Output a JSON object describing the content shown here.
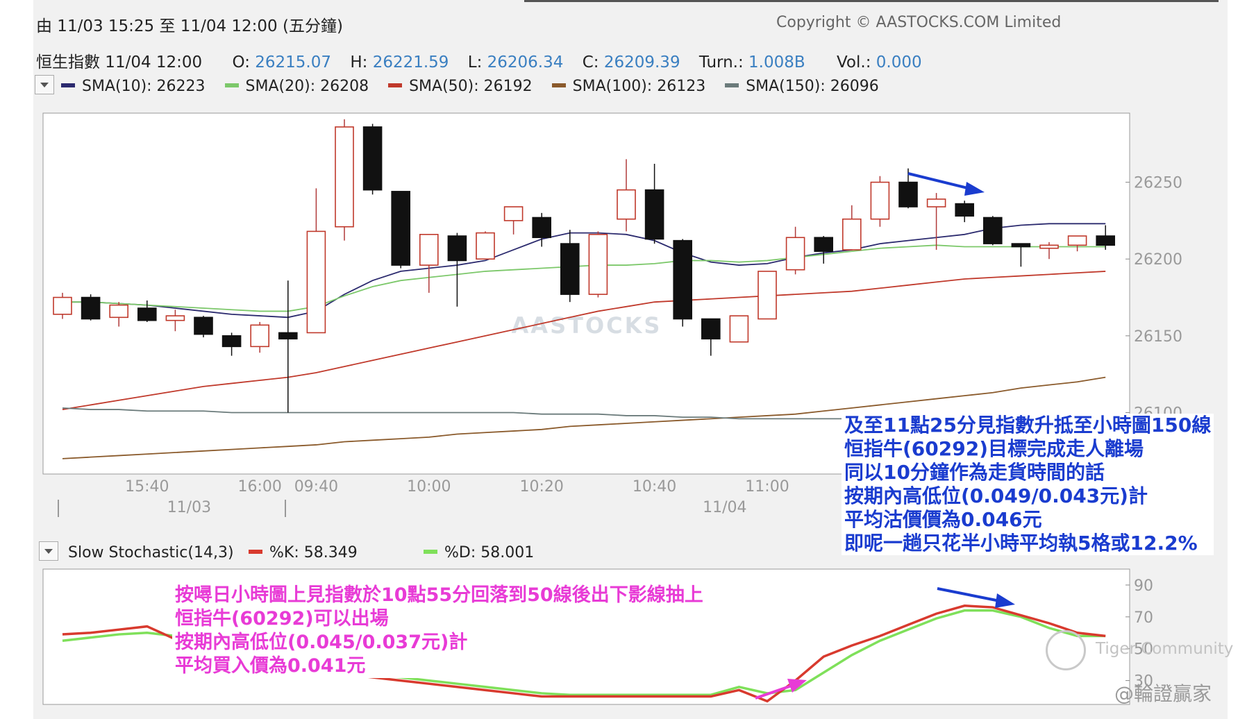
{
  "header": {
    "range": "由 11/03 15:25 至 11/04 12:00 (五分鐘)",
    "copyright": "Copyright © AASTOCKS.COM Limited"
  },
  "quote": {
    "name_time": "恒生指數 11/04 12:00",
    "o_label": "O:",
    "o_value": "26215.07",
    "h_label": "H:",
    "h_value": "26221.59",
    "l_label": "L:",
    "l_value": "26206.34",
    "c_label": "C:",
    "c_value": "26209.39",
    "turn_label": "Turn.:",
    "turn_value": "1.008B",
    "vol_label": "Vol.:",
    "vol_value": "0.000"
  },
  "sma_legend": [
    {
      "label": "SMA(10): 26223",
      "color": "#2b2a6e"
    },
    {
      "label": "SMA(20): 26208",
      "color": "#7cc86a"
    },
    {
      "label": "SMA(50): 26192",
      "color": "#c0392b"
    },
    {
      "label": "SMA(100): 26123",
      "color": "#8a5a2b"
    },
    {
      "label": "SMA(150): 26096",
      "color": "#6b7b7b"
    }
  ],
  "stoch": {
    "title": "Slow Stochastic(14,3)",
    "k_label": "%K: 58.349",
    "k_color": "#d83a2e",
    "d_label": "%D: 58.001",
    "d_color": "#7fe05a"
  },
  "watermarks": {
    "main": "AASTOCKS",
    "community": "Tiger Community",
    "author": "@輪證贏家"
  },
  "annotations": {
    "blue": [
      "及至11點25分見指數升抵至小時圖150線",
      "恒指牛(60292)目標完成走人離場",
      "同以10分鐘作為走貨時間的話",
      "按期內高低位(0.049/0.043元)計",
      "平均沽價價為0.046元",
      "即呢一趟只花半小時平均執5格或12.2%"
    ],
    "pink": [
      "按噚日小時圖上見指數於10點55分回落到50線後出下影線抽上",
      "恒指牛(60292)可以出場",
      "按期內高低位(0.045/0.037元)計",
      "平均買入價為0.041元"
    ]
  },
  "chart_data": [
    {
      "type": "candlestick",
      "title": "恒生指數",
      "ylim": [
        26060,
        26295
      ],
      "y_ticks": [
        26100,
        26150,
        26200,
        26250
      ],
      "time_ticks": [
        {
          "index": 3,
          "label": "15:40"
        },
        {
          "index": 7,
          "label": "16:00"
        },
        {
          "index": 9,
          "label": "09:40"
        },
        {
          "index": 13,
          "label": "10:00"
        },
        {
          "index": 17,
          "label": "10:20"
        },
        {
          "index": 21,
          "label": "10:40"
        },
        {
          "index": 25,
          "label": "11:00"
        }
      ],
      "date_labels": [
        {
          "index": 4,
          "label": "11/03"
        },
        {
          "index": 23,
          "label": "11/04"
        }
      ],
      "candles": [
        {
          "o": 26164,
          "h": 26178,
          "l": 26161,
          "c": 26175
        },
        {
          "o": 26175,
          "h": 26177,
          "l": 26160,
          "c": 26161
        },
        {
          "o": 26162,
          "h": 26172,
          "l": 26156,
          "c": 26170
        },
        {
          "o": 26168,
          "h": 26173,
          "l": 26159,
          "c": 26160
        },
        {
          "o": 26160,
          "h": 26167,
          "l": 26153,
          "c": 26163
        },
        {
          "o": 26162,
          "h": 26163,
          "l": 26149,
          "c": 26151
        },
        {
          "o": 26150,
          "h": 26152,
          "l": 26137,
          "c": 26143
        },
        {
          "o": 26143,
          "h": 26159,
          "l": 26139,
          "c": 26157
        },
        {
          "o": 26152,
          "h": 26186,
          "l": 26100,
          "c": 26148
        },
        {
          "o": 26152,
          "h": 26246,
          "l": 26152,
          "c": 26218
        },
        {
          "o": 26221,
          "h": 26291,
          "l": 26212,
          "c": 26286
        },
        {
          "o": 26286,
          "h": 26288,
          "l": 26242,
          "c": 26245
        },
        {
          "o": 26244,
          "h": 26244,
          "l": 26194,
          "c": 26196
        },
        {
          "o": 26196,
          "h": 26213,
          "l": 26178,
          "c": 26216
        },
        {
          "o": 26215,
          "h": 26217,
          "l": 26169,
          "c": 26199
        },
        {
          "o": 26200,
          "h": 26218,
          "l": 26200,
          "c": 26217
        },
        {
          "o": 26225,
          "h": 26231,
          "l": 26216,
          "c": 26234
        },
        {
          "o": 26227,
          "h": 26230,
          "l": 26208,
          "c": 26214
        },
        {
          "o": 26210,
          "h": 26219,
          "l": 26172,
          "c": 26177
        },
        {
          "o": 26177,
          "h": 26218,
          "l": 26175,
          "c": 26216
        },
        {
          "o": 26226,
          "h": 26265,
          "l": 26218,
          "c": 26245
        },
        {
          "o": 26245,
          "h": 26262,
          "l": 26210,
          "c": 26213
        },
        {
          "o": 26212,
          "h": 26213,
          "l": 26156,
          "c": 26161
        },
        {
          "o": 26161,
          "h": 26161,
          "l": 26137,
          "c": 26148
        },
        {
          "o": 26146,
          "h": 26163,
          "l": 26146,
          "c": 26163
        },
        {
          "o": 26161,
          "h": 26192,
          "l": 26161,
          "c": 26192
        },
        {
          "o": 26193,
          "h": 26221,
          "l": 26190,
          "c": 26214
        },
        {
          "o": 26214,
          "h": 26215,
          "l": 26197,
          "c": 26205
        },
        {
          "o": 26206,
          "h": 26235,
          "l": 26206,
          "c": 26226
        },
        {
          "o": 26226,
          "h": 26254,
          "l": 26221,
          "c": 26250
        },
        {
          "o": 26250,
          "h": 26259,
          "l": 26233,
          "c": 26234
        },
        {
          "o": 26234,
          "h": 26243,
          "l": 26206,
          "c": 26239
        },
        {
          "o": 26236,
          "h": 26238,
          "l": 26224,
          "c": 26228
        },
        {
          "o": 26227,
          "h": 26228,
          "l": 26209,
          "c": 26210
        },
        {
          "o": 26210,
          "h": 26210,
          "l": 26195,
          "c": 26208
        },
        {
          "o": 26207,
          "h": 26211,
          "l": 26200,
          "c": 26209
        },
        {
          "o": 26209,
          "h": 26215,
          "l": 26205,
          "c": 26215
        },
        {
          "o": 26215,
          "h": 26222,
          "l": 26206,
          "c": 26209
        }
      ],
      "series": [
        {
          "name": "SMA(10)",
          "values": [
            26172,
            26172,
            26171,
            26170,
            26168,
            26166,
            26164,
            26163,
            26162,
            26166,
            26177,
            26186,
            26192,
            26194,
            26196,
            26199,
            26206,
            26213,
            26217,
            26217,
            26216,
            26212,
            26204,
            26198,
            26196,
            26197,
            26201,
            26204,
            26206,
            26210,
            26212,
            26214,
            26216,
            26220,
            26222,
            26223,
            26223,
            26223
          ]
        },
        {
          "name": "SMA(20)",
          "values": [
            26172,
            26172,
            26171,
            26170,
            26169,
            26168,
            26167,
            26166,
            26166,
            26169,
            26176,
            26182,
            26186,
            26188,
            26190,
            26192,
            26193,
            26194,
            26195,
            26196,
            26196,
            26197,
            26199,
            26199,
            26198,
            26199,
            26201,
            26203,
            26205,
            26207,
            26208,
            26209,
            26208,
            26208,
            26208,
            26208,
            26208,
            26208
          ]
        },
        {
          "name": "SMA(50)",
          "values": [
            26102,
            26105,
            26108,
            26111,
            26114,
            26117,
            26119,
            26121,
            26123,
            26126,
            26130,
            26134,
            26138,
            26142,
            26146,
            26150,
            26154,
            26158,
            26162,
            26166,
            26169,
            26172,
            26173,
            26174,
            26175,
            26176,
            26177,
            26178,
            26179,
            26181,
            26183,
            26185,
            26187,
            26188,
            26189,
            26190,
            26191,
            26192
          ]
        },
        {
          "name": "SMA(100)",
          "values": [
            26070,
            26071,
            26072,
            26073,
            26074,
            26075,
            26076,
            26077,
            26078,
            26079,
            26081,
            26082,
            26083,
            26084,
            26086,
            26087,
            26088,
            26089,
            26091,
            26092,
            26093,
            26094,
            26095,
            26096,
            26097,
            26098,
            26099,
            26101,
            26103,
            26105,
            26107,
            26109,
            26111,
            26113,
            26116,
            26118,
            26120,
            26123
          ]
        },
        {
          "name": "SMA(150)",
          "values": [
            26103,
            26102,
            26102,
            26101,
            26101,
            26101,
            26100,
            26100,
            26100,
            26100,
            26100,
            26100,
            26100,
            26100,
            26100,
            26100,
            26100,
            26099,
            26099,
            26099,
            26098,
            26098,
            26097,
            26097,
            26096,
            26096,
            26096,
            26096,
            26096,
            26096,
            26096,
            26096,
            26096,
            26096,
            26096,
            26096,
            26096,
            26096
          ]
        }
      ]
    },
    {
      "type": "line",
      "title": "Slow Stochastic(14,3)",
      "ylim": [
        15,
        100
      ],
      "y_ticks": [
        30,
        50,
        70,
        90
      ],
      "series": [
        {
          "name": "%K",
          "values": [
            59,
            60,
            62,
            64,
            56,
            50,
            46,
            42,
            38,
            36,
            34,
            32,
            30,
            28,
            26,
            24,
            22,
            20,
            20,
            20,
            20,
            20,
            20,
            20,
            24,
            17,
            30,
            45,
            52,
            58,
            65,
            72,
            77,
            76,
            71,
            66,
            60,
            58
          ]
        },
        {
          "name": "%D",
          "values": [
            55,
            57,
            59,
            60,
            58,
            52,
            48,
            44,
            40,
            38,
            36,
            34,
            32,
            30,
            28,
            26,
            24,
            22,
            21,
            21,
            21,
            21,
            21,
            21,
            26,
            22,
            24,
            35,
            46,
            55,
            62,
            69,
            74,
            74,
            70,
            63,
            58,
            58
          ]
        }
      ]
    }
  ]
}
